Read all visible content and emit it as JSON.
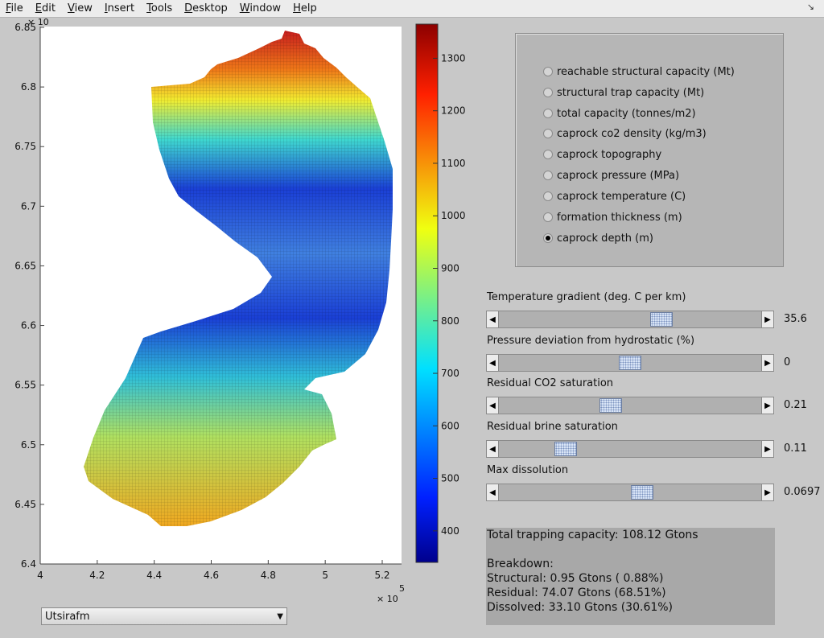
{
  "menu": [
    "File",
    "Edit",
    "View",
    "Insert",
    "Tools",
    "Desktop",
    "Window",
    "Help"
  ],
  "menu_underline": [
    "F",
    "E",
    "V",
    "I",
    "T",
    "D",
    "W",
    "H"
  ],
  "menu_rest": [
    "ile",
    "dit",
    "iew",
    "nsert",
    "ools",
    "esktop",
    "indow",
    "elp"
  ],
  "corner_icon": "↘",
  "plot": {
    "x_ticks": [
      "4",
      "4.2",
      "4.4",
      "4.6",
      "4.8",
      "5",
      "5.2"
    ],
    "x_tick_values": [
      4,
      4.2,
      4.4,
      4.6,
      4.8,
      5,
      5.2
    ],
    "x_exponent": "× 10",
    "x_exponent_power": "5",
    "y_ticks": [
      "6.4",
      "6.45",
      "6.5",
      "6.55",
      "6.6",
      "6.65",
      "6.7",
      "6.75",
      "6.8",
      "6.85"
    ],
    "y_tick_values": [
      6.4,
      6.45,
      6.5,
      6.55,
      6.6,
      6.65,
      6.7,
      6.75,
      6.8,
      6.85
    ],
    "y_exponent": "× 10",
    "colorbar_ticks": [
      "400",
      "500",
      "600",
      "700",
      "800",
      "900",
      "1000",
      "1100",
      "1200",
      "1300"
    ],
    "colorbar_values": [
      400,
      500,
      600,
      700,
      800,
      900,
      1000,
      1100,
      1200,
      1300
    ],
    "colorbar_range": [
      340,
      1365
    ]
  },
  "radio_options": [
    {
      "label": "reachable structural capacity (Mt)",
      "checked": false
    },
    {
      "label": "structural trap capacity (Mt)",
      "checked": false
    },
    {
      "label": "total capacity (tonnes/m2)",
      "checked": false
    },
    {
      "label": "caprock co2 density (kg/m3)",
      "checked": false
    },
    {
      "label": "caprock topography",
      "checked": false
    },
    {
      "label": "caprock pressure (MPa)",
      "checked": false
    },
    {
      "label": "caprock temperature (C)",
      "checked": false
    },
    {
      "label": "formation thickness (m)",
      "checked": false
    },
    {
      "label": "caprock depth (m)",
      "checked": true
    }
  ],
  "sliders": [
    {
      "label": "Temperature gradient (deg. C per km)",
      "value": "35.6",
      "position": 0.63
    },
    {
      "label": "Pressure deviation from hydrostatic (%)",
      "value": "0",
      "position": 0.5
    },
    {
      "label": "Residual CO2 saturation",
      "value": "0.21",
      "position": 0.42
    },
    {
      "label": "Residual brine saturation",
      "value": "0.11",
      "position": 0.23
    },
    {
      "label": "Max dissolution",
      "value": "0.0697",
      "position": 0.55
    }
  ],
  "summary": {
    "total": "Total trapping capacity: 108.12 Gtons",
    "breakdown": "Breakdown:",
    "structural": "Structural: 0.95 Gtons ( 0.88%)",
    "residual": "Residual: 74.07 Gtons (68.51%)",
    "dissolved": "Dissolved: 33.10 Gtons (30.61%)"
  },
  "formation_select": {
    "value": "Utsirafm",
    "arrow": "▼"
  },
  "slider_arrows": {
    "left": "◀",
    "right": "▶"
  }
}
